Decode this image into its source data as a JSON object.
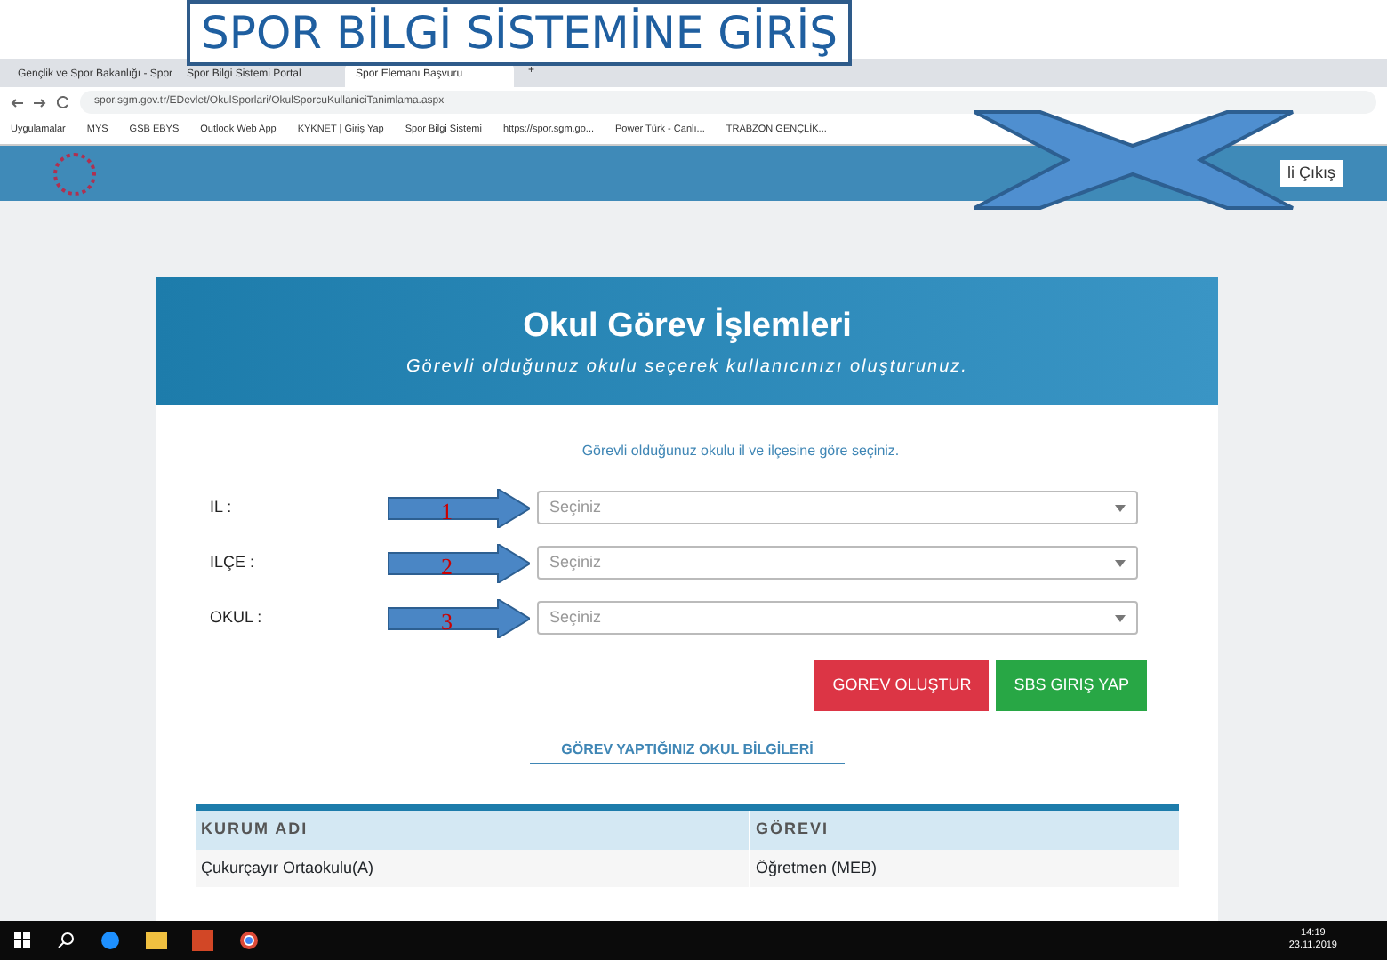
{
  "slide_title": "SPOR BİLGİ SİSTEMİNE GİRİŞ",
  "browser": {
    "tabs": [
      {
        "label": "Gençlik ve Spor Bakanlığı - Spor",
        "selected": false
      },
      {
        "label": "Spor Bilgi Sistemi Portal",
        "selected": false
      },
      {
        "label": "Spor Elemanı Başvuru",
        "selected": true
      }
    ],
    "new_tab": "+",
    "url": "spor.sgm.gov.tr/EDevlet/OkulSporlari/OkulSporcuKullaniciTanimlama.aspx",
    "bookmarks": [
      "Uygulamalar",
      "MYS",
      "GSB EBYS",
      "Outlook Web App",
      "KYKNET | Giriş Yap",
      "Spor Bilgi Sistemi",
      "https://spor.sgm.go...",
      "Power Türk - Canlı...",
      "TRABZON GENÇLİK..."
    ]
  },
  "site_header": {
    "logout": "li Çıkış"
  },
  "card": {
    "title": "Okul Görev İşlemleri",
    "subtitle": "Görevli olduğunuz okulu seçerek kullanıcınızı oluşturunuz.",
    "instruction": "Görevli olduğunuz okulu il ve ilçesine göre seçiniz.",
    "fields": [
      {
        "label": "IL :",
        "placeholder": "Seçiniz",
        "callout": "1"
      },
      {
        "label": "ILÇE :",
        "placeholder": "Seçiniz",
        "callout": "2"
      },
      {
        "label": "OKUL :",
        "placeholder": "Seçiniz",
        "callout": "3"
      }
    ],
    "buttons": [
      {
        "label": "GOREV OLUŞTUR",
        "kind": "danger"
      },
      {
        "label": "SBS GIRIŞ YAP",
        "kind": "success"
      }
    ],
    "section_title": "GÖREV YAPTIĞINIZ OKUL BİLGİLERİ",
    "table": {
      "columns": [
        "KURUM ADI",
        "GÖREVI"
      ],
      "rows": [
        [
          "Çukurçayır Ortaokulu(A)",
          "Öğretmen (MEB)"
        ]
      ]
    }
  },
  "taskbar": {
    "time": "14:19",
    "date": "23.11.2019"
  }
}
